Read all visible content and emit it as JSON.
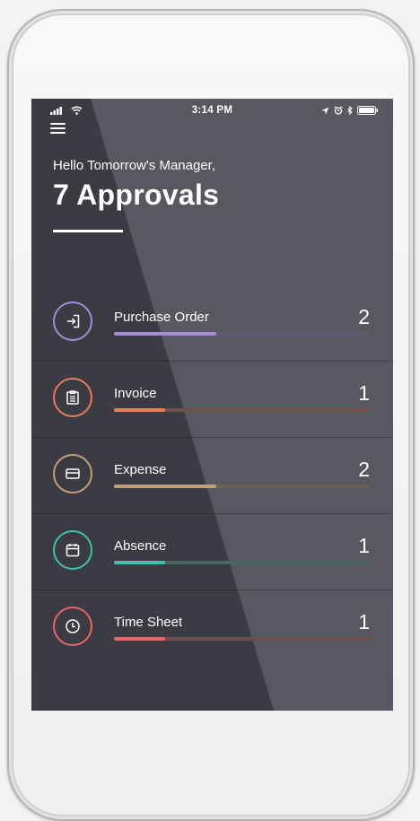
{
  "status_bar": {
    "time": "3:14 PM"
  },
  "header": {
    "greeting": "Hello Tomorrow's Manager,",
    "title": "7 Approvals"
  },
  "items": [
    {
      "label": "Purchase Order",
      "count": "2",
      "color": "#a68dd3",
      "track": "#5f5a6f",
      "progress": 0.4
    },
    {
      "label": "Invoice",
      "count": "1",
      "color": "#ee7c59",
      "track": "#6e524d",
      "progress": 0.2
    },
    {
      "label": "Expense",
      "count": "2",
      "color": "#c29f78",
      "track": "#6a6055",
      "progress": 0.4
    },
    {
      "label": "Absence",
      "count": "1",
      "color": "#3fc1b0",
      "track": "#4a6462",
      "progress": 0.2
    },
    {
      "label": "Time Sheet",
      "count": "1",
      "color": "#ea6469",
      "track": "#6c4d51",
      "progress": 0.2
    }
  ],
  "icons": [
    "exit-icon",
    "clipboard-icon",
    "card-icon",
    "calendar-icon",
    "clock-icon"
  ]
}
